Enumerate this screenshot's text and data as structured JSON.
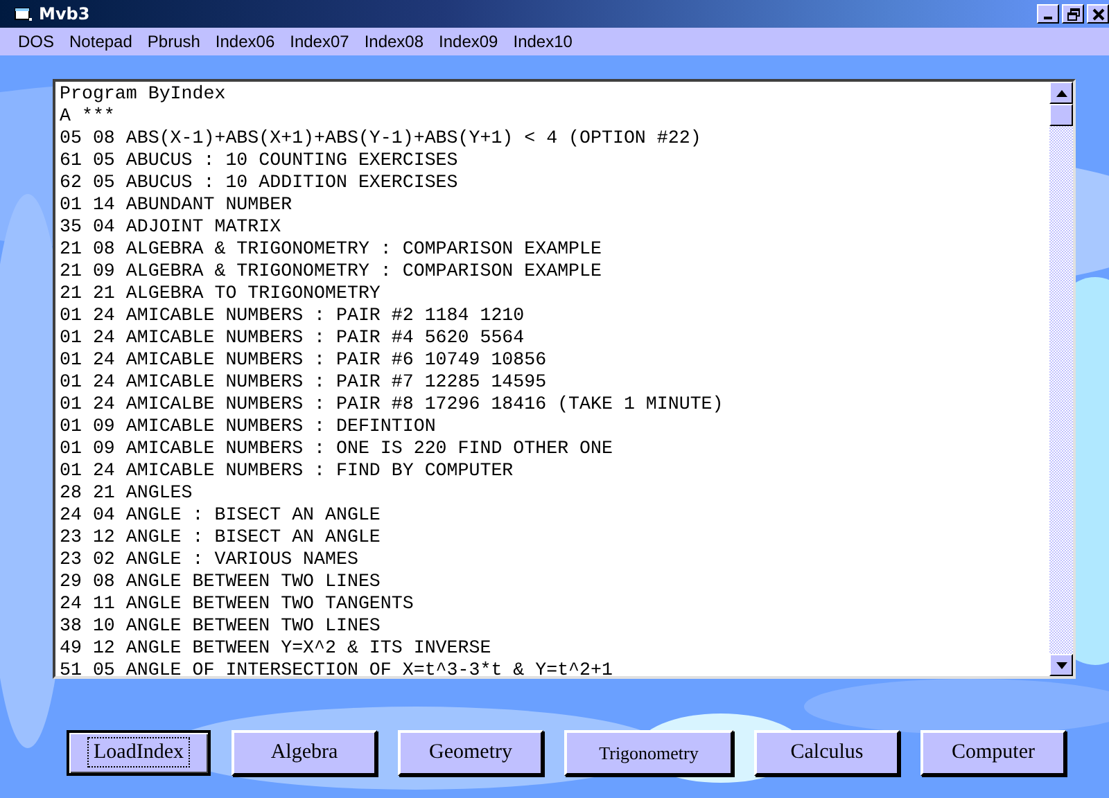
{
  "window": {
    "title": "Mvb3"
  },
  "menu": [
    "DOS",
    "Notepad",
    "Pbrush",
    "Index06",
    "Index07",
    "Index08",
    "Index09",
    "Index10"
  ],
  "list": {
    "lines": [
      "Program ByIndex",
      "A ***",
      "05 08 ABS(X-1)+ABS(X+1)+ABS(Y-1)+ABS(Y+1) < 4 (OPTION #22)",
      "61 05 ABUCUS : 10 COUNTING EXERCISES",
      "62 05 ABUCUS : 10 ADDITION EXERCISES",
      "01 14 ABUNDANT NUMBER",
      "35 04 ADJOINT MATRIX",
      "21 08 ALGEBRA & TRIGONOMETRY : COMPARISON EXAMPLE",
      "21 09 ALGEBRA & TRIGONOMETRY : COMPARISON EXAMPLE",
      "21 21 ALGEBRA TO TRIGONOMETRY",
      "01 24 AMICABLE NUMBERS : PAIR #2 1184 1210",
      "01 24 AMICABLE NUMBERS : PAIR #4 5620 5564",
      "01 24 AMICABLE NUMBERS : PAIR #6 10749 10856",
      "01 24 AMICABLE NUMBERS : PAIR #7 12285 14595",
      "01 24 AMICALBE NUMBERS : PAIR #8 17296 18416 (TAKE 1 MINUTE)",
      "01 09 AMICABLE NUMBERS : DEFINTION",
      "01 09 AMICABLE NUMBERS : ONE IS 220 FIND OTHER ONE",
      "01 24 AMICABLE NUMBERS : FIND BY COMPUTER",
      "28 21 ANGLES",
      "24 04 ANGLE : BISECT AN ANGLE",
      "23 12 ANGLE : BISECT AN ANGLE",
      "23 02 ANGLE : VARIOUS NAMES",
      "29 08 ANGLE BETWEEN TWO LINES",
      "24 11 ANGLE BETWEEN TWO TANGENTS",
      "38 10 ANGLE BETWEEN TWO LINES",
      "49 12 ANGLE BETWEEN Y=X^2 & ITS INVERSE",
      "51 05 ANGLE OF INTERSECTION OF X=t^3-3*t & Y=t^2+1"
    ]
  },
  "buttons": [
    {
      "label": "LoadIndex",
      "selected": true
    },
    {
      "label": "Algebra",
      "selected": false
    },
    {
      "label": "Geometry",
      "selected": false
    },
    {
      "label": "Trigonometry",
      "selected": false
    },
    {
      "label": "Calculus",
      "selected": false
    },
    {
      "label": "Computer",
      "selected": false
    }
  ]
}
